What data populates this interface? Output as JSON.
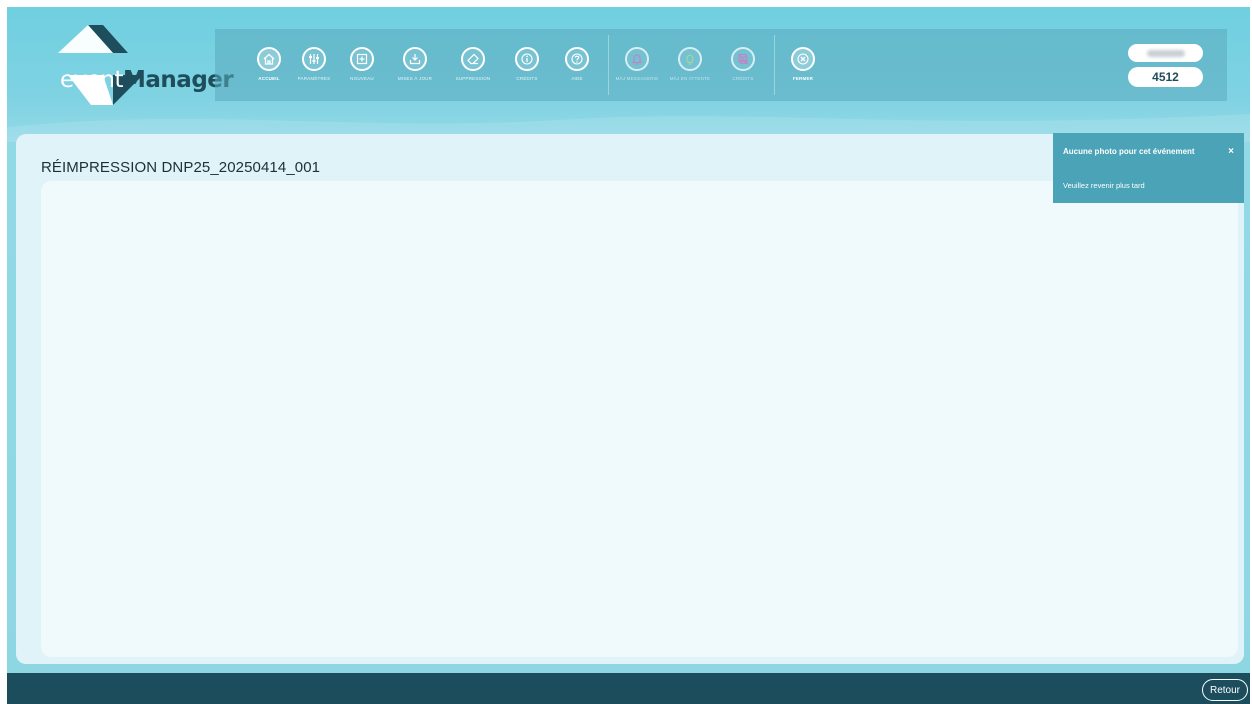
{
  "logo": {
    "text_light": "event",
    "text_bold": "Manager"
  },
  "toolbar": {
    "items": [
      {
        "label": "ACCUEIL",
        "icon": "home-icon"
      },
      {
        "label": "PARAMÈTRES",
        "icon": "sliders-icon"
      },
      {
        "label": "NOUVEAU",
        "icon": "plus-square-icon"
      },
      {
        "label": "MISES À JOUR",
        "icon": "download-tray-icon"
      },
      {
        "label": "SUPPRESSION",
        "icon": "eraser-icon"
      },
      {
        "label": "CRÉDITS",
        "icon": "info-icon"
      },
      {
        "label": "AIDE",
        "icon": "help-icon"
      },
      {
        "label": "MÀJ MESSAGERIE",
        "icon": "bell-icon"
      },
      {
        "label": "MÀJ EN ATTENTE",
        "icon": "lightbulb-icon"
      },
      {
        "label": "CRÉDITS",
        "icon": "print-off-icon"
      },
      {
        "label": "FERMER",
        "icon": "close-circle-icon"
      }
    ]
  },
  "account": {
    "number": "4512"
  },
  "panel": {
    "title": "RÉIMPRESSION DNP25_20250414_001"
  },
  "toast": {
    "title": "Aucune photo pour cet événement",
    "close": "×",
    "message": "Veuillez revenir plus tard"
  },
  "footer": {
    "back_label": "Retour"
  },
  "colors": {
    "header_bg": "#6fd0e0",
    "brand_dark": "#1c4d5d",
    "toast_bg": "#4aa3b6",
    "panel_bg": "#dff3f8",
    "bell_accent": "#e46fc0",
    "bulb_accent": "#b6e38a"
  }
}
